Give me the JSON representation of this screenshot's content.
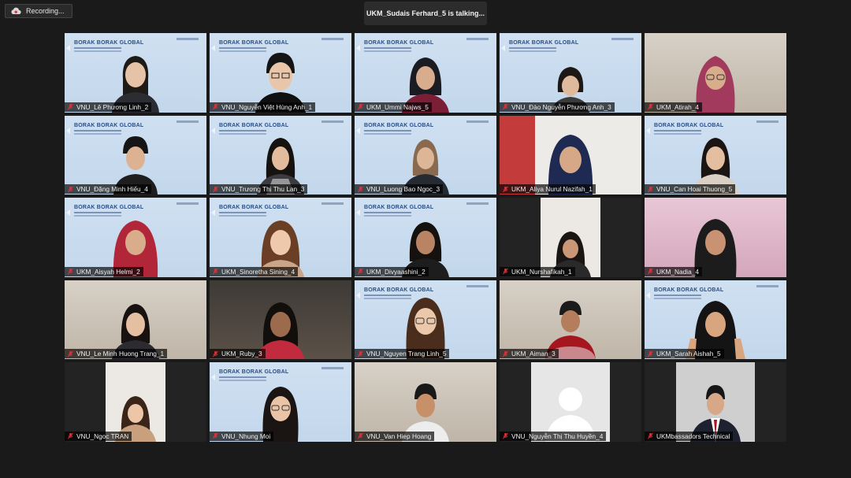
{
  "recording": {
    "label": "Recording...",
    "icon": "recording-cloud-icon"
  },
  "active_speaker": {
    "text": "UKM_Sudais Ferhard_5 is talking..."
  },
  "slide": {
    "title": "BORAK BORAK GLOBAL"
  },
  "colors": {
    "mic_muted": "#e0323a",
    "background": "#1a1a1a",
    "slide_blue": "#c6daee"
  },
  "participants": [
    {
      "name": "VNU_Lê Phương Linh_2",
      "muted": true
    },
    {
      "name": "VNU_Nguyễn Việt Hùng Anh_1",
      "muted": true
    },
    {
      "name": "UKM_Ummi Najws_5",
      "muted": true
    },
    {
      "name": "VNU_Đào Nguyễn Phương Anh_3",
      "muted": true
    },
    {
      "name": "UKM_Atirah_4",
      "muted": true
    },
    {
      "name": "VNU_Đặng Minh Hiếu_4",
      "muted": true
    },
    {
      "name": "VNU_Trương Thị Thu Lan_3",
      "muted": true
    },
    {
      "name": "VNU_Luong Bao Ngoc_3",
      "muted": true
    },
    {
      "name": "UKM_Aliya Nurul Nazifah_1",
      "muted": true
    },
    {
      "name": "VNU_Can Hoai Thuong_5",
      "muted": true
    },
    {
      "name": "UKM_Aisyah Helmi_2",
      "muted": true
    },
    {
      "name": "UKM_Sinoretha Sining_4",
      "muted": true
    },
    {
      "name": "UKM_Divyaashini_2",
      "muted": true
    },
    {
      "name": "UKM_Nurshafikah_1",
      "muted": true
    },
    {
      "name": "UKM_Nadia_4",
      "muted": true
    },
    {
      "name": "VNU_Le Minh Huong Trang_1",
      "muted": true
    },
    {
      "name": "UKM_Ruby_3",
      "muted": true
    },
    {
      "name": "VNU_Nguyen Trang Linh_5",
      "muted": true
    },
    {
      "name": "UKM_Aiman_3",
      "muted": true
    },
    {
      "name": "UKM_Sarah Aishah_5",
      "muted": true
    },
    {
      "name": "VNU_Ngoc TRAN",
      "muted": true
    },
    {
      "name": "VNU_Nhung Moi",
      "muted": true
    },
    {
      "name": "VNU_Van Hiep Hoang",
      "muted": true
    },
    {
      "name": "VNU_Nguyễn Thị Thu Huyền_4",
      "muted": true
    },
    {
      "name": "UKMbassadors Technical",
      "muted": true
    }
  ]
}
